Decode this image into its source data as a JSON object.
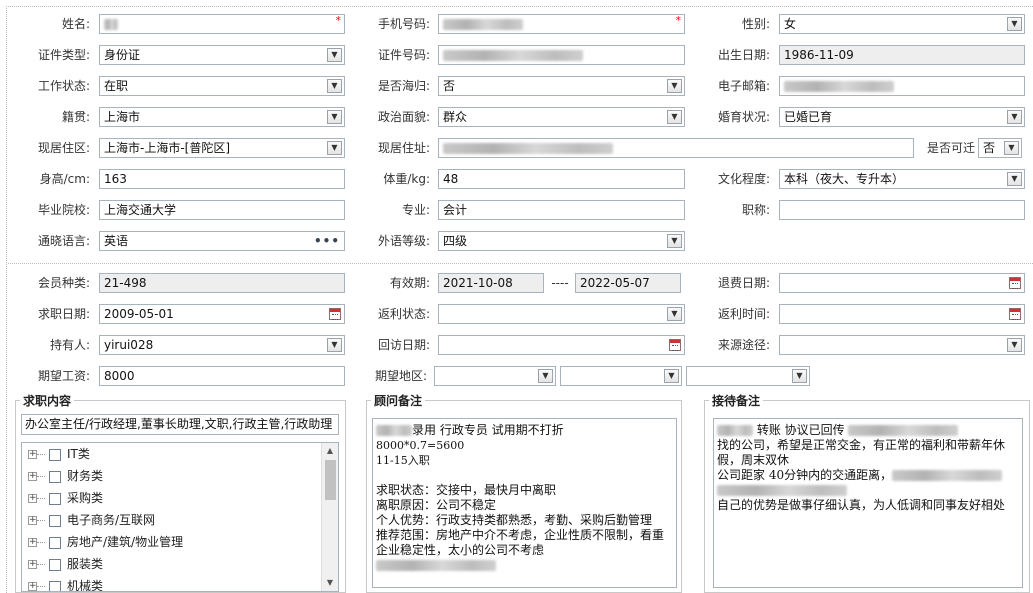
{
  "basic": {
    "name_label": "姓名:",
    "mobile_label": "手机号码:",
    "gender_label": "性别:",
    "gender_value": "女",
    "id_type_label": "证件类型:",
    "id_type_value": "身份证",
    "id_no_label": "证件号码:",
    "birth_label": "出生日期:",
    "birth_value": "1986-11-09",
    "work_status_label": "工作状态:",
    "work_status_value": "在职",
    "returnee_label": "是否海归:",
    "returnee_value": "否",
    "email_label": "电子邮箱:",
    "native_label": "籍贯:",
    "native_value": "上海市",
    "political_label": "政治面貌:",
    "political_value": "群众",
    "marital_label": "婚育状况:",
    "marital_value": "已婚已育",
    "residence_area_label": "现居住区:",
    "residence_area_value": "上海市-上海市-[普陀区]",
    "address_label": "现居住址:",
    "relocate_label": "是否可迁",
    "relocate_value": "否",
    "height_label": "身高/cm:",
    "height_value": "163",
    "weight_label": "体重/kg:",
    "weight_value": "48",
    "education_label": "文化程度:",
    "education_value": "本科（夜大、专升本）",
    "school_label": "毕业院校:",
    "school_value": "上海交通大学",
    "major_label": "专业:",
    "major_value": "会计",
    "title_label": "职称:",
    "title_value": "",
    "language_label": "通晓语言:",
    "language_value": "英语",
    "foreign_level_label": "外语等级:",
    "foreign_level_value": "四级",
    "required_mark": "*",
    "more_dots": "•••"
  },
  "membership": {
    "member_type_label": "会员种类:",
    "member_type_value": "21-498",
    "validity_label": "有效期:",
    "validity_from": "2021-10-08",
    "validity_sep": "----",
    "validity_to": "2022-05-07",
    "refund_date_label": "退费日期:",
    "job_date_label": "求职日期:",
    "job_date_value": "2009-05-01",
    "rebate_status_label": "返利状态:",
    "rebate_time_label": "返利时间:",
    "holder_label": "持有人:",
    "holder_value": "yirui028",
    "visit_date_label": "回访日期:",
    "source_label": "来源途径:",
    "salary_label": "期望工资:",
    "salary_value": "8000",
    "region_label": "期望地区:"
  },
  "job_content": {
    "legend": "求职内容",
    "summary": "办公室主任/行政经理,董事长助理,文职,行政主管,行政助理",
    "categories": [
      "IT类",
      "财务类",
      "采购类",
      "电子商务/互联网",
      "房地产/建筑/物业管理",
      "服装类",
      "机械类"
    ],
    "tree_plus": "+"
  },
  "advisor_notes": {
    "legend": "顾问备注",
    "line1": "录用 行政专员  试用期不打折",
    "line2": "8000*0.7=5600",
    "line3": "11-15入职",
    "line4": "求职状态：交接中，最快月中离职",
    "line5": "离职原因：公司不稳定",
    "line6": "个人优势：行政支持类都熟悉，考勤、采购后勤管理",
    "line7": "推荐范围：房地产中介不考虑，企业性质不限制，看重",
    "line8": "企业稳定性，太小的公司不考虑"
  },
  "reception_notes": {
    "legend": "接待备注",
    "line1": "转账 协议已回传",
    "line2": "找的公司，希望是正常交金，有正常的福利和带薪年休",
    "line3": "假，周末双休",
    "line4": "公司距家 40分钟内的交通距离，",
    "line5": "自己的优势是做事仔细认真，为人低调和同事友好相处"
  },
  "icons": {
    "dropdown": "▼",
    "scroll_up": "▲",
    "scroll_down": "▼"
  }
}
